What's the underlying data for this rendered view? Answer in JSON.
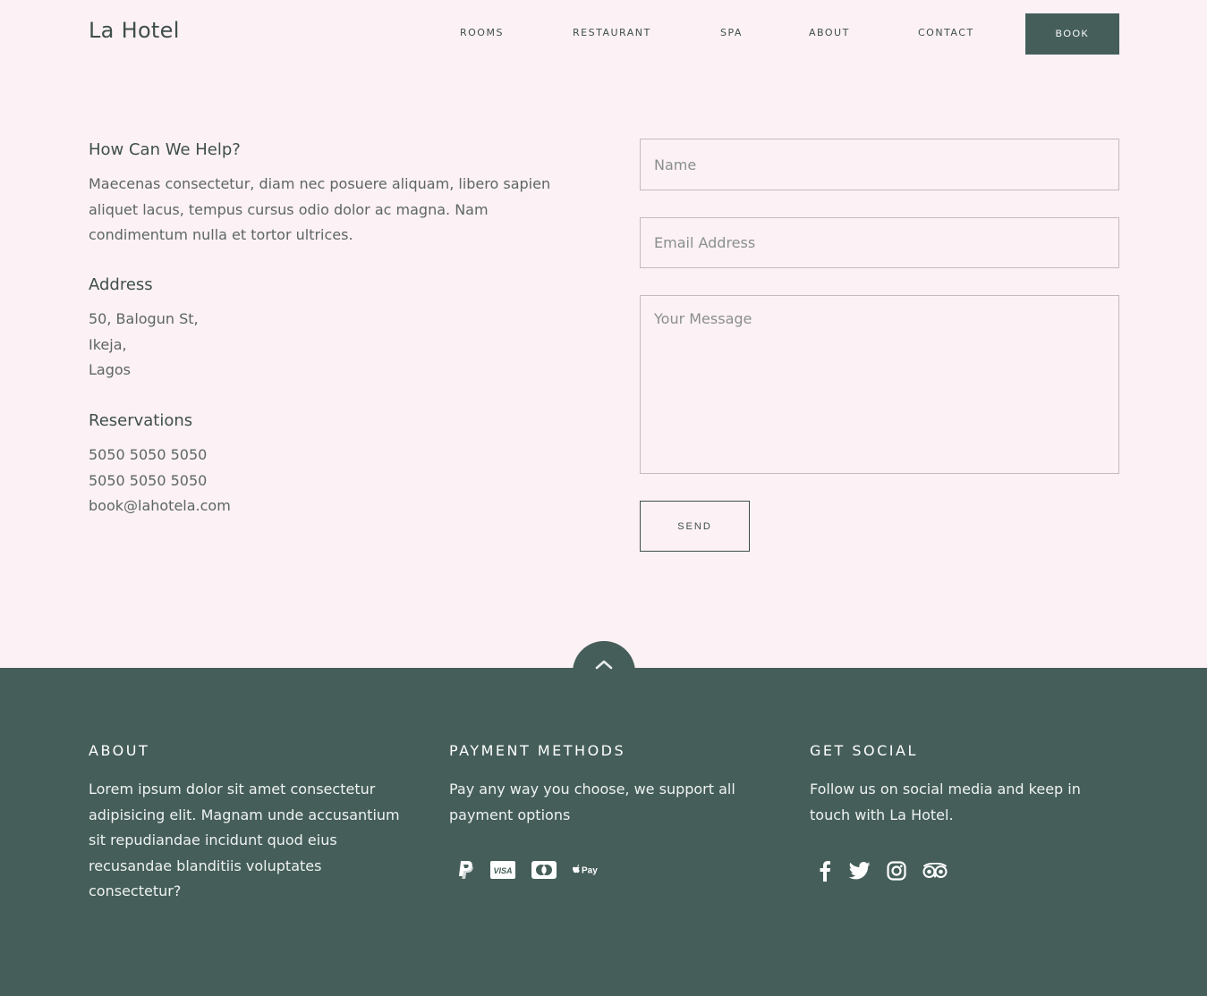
{
  "header": {
    "logo": "La Hotel",
    "nav": [
      "ROOMS",
      "RESTAURANT",
      "SPA",
      "ABOUT",
      "CONTACT"
    ],
    "book_label": "BOOK"
  },
  "info": {
    "help_title": "How Can We Help?",
    "help_text": "Maecenas consectetur, diam nec posuere aliquam, libero sapien aliquet lacus, tempus cursus odio dolor ac magna. Nam condimentum nulla et tortor ultrices.",
    "address_title": "Address",
    "address_lines": [
      "50, Balogun St,",
      "Ikeja,",
      "Lagos"
    ],
    "reservations_title": "Reservations",
    "reservation_lines": [
      "5050 5050 5050",
      "5050 5050 5050",
      "book@lahotela.com"
    ]
  },
  "form": {
    "name_placeholder": "Name",
    "email_placeholder": "Email Address",
    "message_placeholder": "Your Message",
    "send_label": "SEND"
  },
  "footer": {
    "about_title": "ABOUT",
    "about_text": "Lorem ipsum dolor sit amet consectetur adipisicing elit. Magnam unde accusantium sit repudiandae incidunt quod eius recusandae blanditiis voluptates consectetur?",
    "payment_title": "PAYMENT METHODS",
    "payment_text": "Pay any way you choose, we support all payment options",
    "payment_icons": [
      "paypal-icon",
      "visa-icon",
      "mastercard-icon",
      "apple-pay-icon"
    ],
    "visa_text": "VISA",
    "applepay_text": "Pay",
    "social_title": "GET SOCIAL",
    "social_text": "Follow us on social media and keep in touch with La Hotel.",
    "social_icons": [
      "facebook-icon",
      "twitter-icon",
      "instagram-icon",
      "tripadvisor-icon"
    ]
  },
  "colors": {
    "accent": "#455e59",
    "background": "#fcf1f5"
  }
}
